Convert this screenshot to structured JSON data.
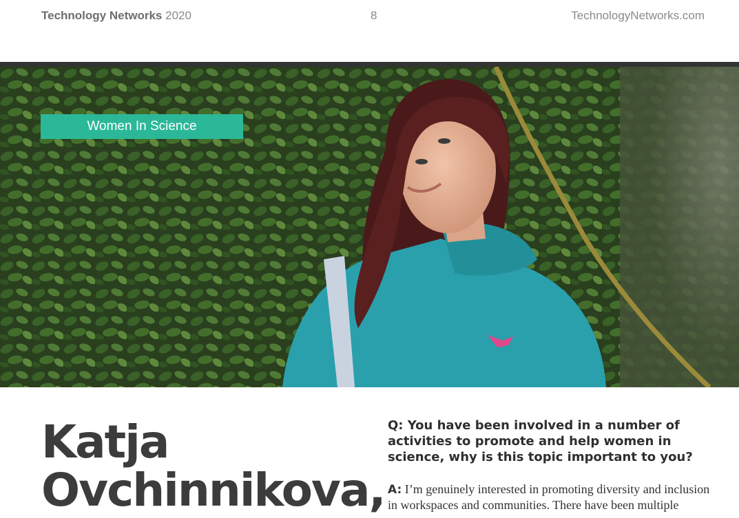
{
  "header": {
    "brand_bold": "Technology Networks",
    "brand_year": "2020",
    "page_number": "8",
    "site": "TechnologyNetworks.com"
  },
  "hero": {
    "tag": "Women In Science"
  },
  "article": {
    "name_line1": "Katja",
    "name_line2": "Ovchinnikova,",
    "question": "Q: You have been involved in a number of activities to promote and help women in science, why is this topic important to you?",
    "answer_label": "A:",
    "answer_text": "I’m genuinely interested in promoting diversity and inclusion in workspaces and communities. There have been multiple"
  },
  "colors": {
    "tag_bg": "#2bb898",
    "rule": "#333333",
    "name": "#3c3c3c",
    "hoodie": "#2aa0ad"
  }
}
